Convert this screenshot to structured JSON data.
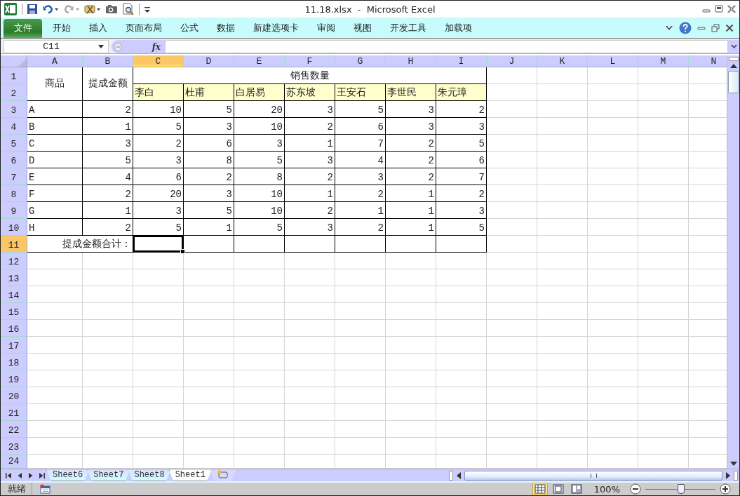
{
  "window": {
    "title": "11.18.xlsx  -  Microsoft Excel"
  },
  "ribbon_tabs": [
    {
      "label": "文件",
      "kind": "file"
    },
    {
      "label": "开始",
      "kind": "tab"
    },
    {
      "label": "插入",
      "kind": "tab"
    },
    {
      "label": "页面布局",
      "kind": "tab"
    },
    {
      "label": "公式",
      "kind": "tab"
    },
    {
      "label": "数据",
      "kind": "tab"
    },
    {
      "label": "新建选项卡",
      "kind": "tab"
    },
    {
      "label": "审阅",
      "kind": "tab"
    },
    {
      "label": "视图",
      "kind": "tab"
    },
    {
      "label": "开发工具",
      "kind": "tab"
    },
    {
      "label": "加载项",
      "kind": "tab"
    }
  ],
  "name_box": {
    "value": "C11"
  },
  "formula_bar": {
    "fx_label": "fx"
  },
  "columns": [
    {
      "label": "A",
      "selected": false
    },
    {
      "label": "B",
      "selected": false
    },
    {
      "label": "C",
      "selected": true
    },
    {
      "label": "D",
      "selected": false
    },
    {
      "label": "E",
      "selected": false
    },
    {
      "label": "F",
      "selected": false
    },
    {
      "label": "G",
      "selected": false
    },
    {
      "label": "H",
      "selected": false
    },
    {
      "label": "I",
      "selected": false
    },
    {
      "label": "J",
      "selected": false
    },
    {
      "label": "K",
      "selected": false
    },
    {
      "label": "L",
      "selected": false
    },
    {
      "label": "M",
      "selected": false
    },
    {
      "label": "N",
      "selected": false
    }
  ],
  "rows": [
    {
      "label": "1",
      "selected": false
    },
    {
      "label": "2",
      "selected": false
    },
    {
      "label": "3",
      "selected": false
    },
    {
      "label": "4",
      "selected": false
    },
    {
      "label": "5",
      "selected": false
    },
    {
      "label": "6",
      "selected": false
    },
    {
      "label": "7",
      "selected": false
    },
    {
      "label": "8",
      "selected": false
    },
    {
      "label": "9",
      "selected": false
    },
    {
      "label": "10",
      "selected": false
    },
    {
      "label": "11",
      "selected": true
    },
    {
      "label": "12",
      "selected": false
    },
    {
      "label": "13",
      "selected": false
    },
    {
      "label": "14",
      "selected": false
    },
    {
      "label": "15",
      "selected": false
    },
    {
      "label": "16",
      "selected": false
    },
    {
      "label": "17",
      "selected": false
    },
    {
      "label": "18",
      "selected": false
    },
    {
      "label": "19",
      "selected": false
    },
    {
      "label": "20",
      "selected": false
    },
    {
      "label": "21",
      "selected": false
    },
    {
      "label": "22",
      "selected": false
    },
    {
      "label": "23",
      "selected": false
    },
    {
      "label": "24",
      "selected": false
    }
  ],
  "table": {
    "product_header": "商品",
    "commission_header": "提成金额",
    "sales_header": "销售数量",
    "salespeople": [
      "李白",
      "杜甫",
      "白居易",
      "苏东坡",
      "王安石",
      "李世民",
      "朱元璋"
    ],
    "items": [
      {
        "product": "A",
        "commission": "2",
        "sales": [
          "10",
          "5",
          "20",
          "3",
          "5",
          "3",
          "2"
        ]
      },
      {
        "product": "B",
        "commission": "1",
        "sales": [
          "5",
          "3",
          "10",
          "2",
          "6",
          "3",
          "3"
        ]
      },
      {
        "product": "C",
        "commission": "3",
        "sales": [
          "2",
          "6",
          "3",
          "1",
          "7",
          "2",
          "5"
        ]
      },
      {
        "product": "D",
        "commission": "5",
        "sales": [
          "3",
          "8",
          "5",
          "3",
          "4",
          "2",
          "6"
        ]
      },
      {
        "product": "E",
        "commission": "4",
        "sales": [
          "6",
          "2",
          "8",
          "2",
          "3",
          "2",
          "7"
        ]
      },
      {
        "product": "F",
        "commission": "2",
        "sales": [
          "20",
          "3",
          "10",
          "1",
          "2",
          "1",
          "2"
        ]
      },
      {
        "product": "G",
        "commission": "1",
        "sales": [
          "3",
          "5",
          "10",
          "2",
          "1",
          "1",
          "3"
        ]
      },
      {
        "product": "H",
        "commission": "2",
        "sales": [
          "5",
          "1",
          "5",
          "3",
          "2",
          "1",
          "5"
        ]
      }
    ],
    "total_label": "提成金额合计："
  },
  "sheet_tabs": [
    {
      "label": "Sheet6",
      "selected": false
    },
    {
      "label": "Sheet7",
      "selected": false
    },
    {
      "label": "Sheet8",
      "selected": false
    },
    {
      "label": "Sheet1",
      "selected": true
    }
  ],
  "status_bar": {
    "text": "就绪",
    "zoom": "100%"
  },
  "view_buttons": [
    {
      "kind": "normal",
      "selected": true
    },
    {
      "kind": "page_layout",
      "selected": false
    },
    {
      "kind": "page_break",
      "selected": false
    }
  ],
  "zoom_slider": {
    "level": 0.5
  }
}
